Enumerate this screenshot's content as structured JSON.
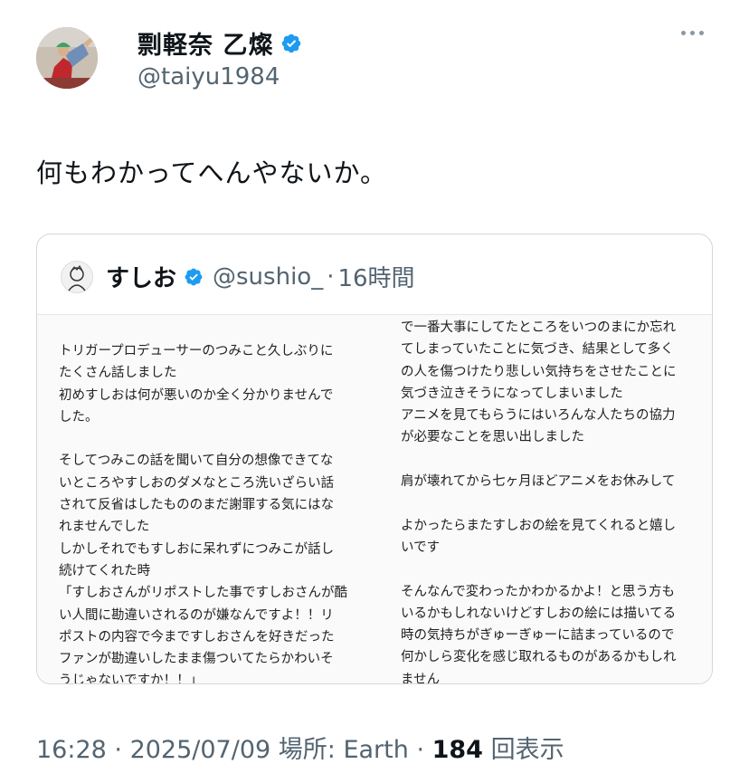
{
  "author": {
    "display_name": "剽軽奈 乙燦",
    "handle": "@taiyu1984",
    "verified_icon": "verified-badge-icon"
  },
  "tweet": {
    "text": "何もわかってへんやないか。"
  },
  "quoted": {
    "display_name": "すしお",
    "handle": "@sushio_",
    "separator": "·",
    "time": "16時間",
    "image_text_left": "トリガープロデューサーのつみこと久しぶりに\nたくさん話しました\n初めすしおは何が悪いのか全く分かりませんで\nした。\n\nそしてつみこの話を聞いて自分の想像できてな\nいところやすしおのダメなところ洗いざらい話\nされて反省はしたもののまだ謝罪する気にはな\nれませんでした\nしかしそれでもすしおに呆れずにつみこが話し\n続けてくれた時\n「すしおさんがリポストした事ですしおさんが酷\nい人間に勘違いされるのが嫌なんですよ！！リ\nポストの内容で今まですしおさんを好きだった\nファンが勘違いしたまま傷ついてたらかわいそ\nうじゃないですか！！」",
    "image_text_right": "で一番大事にしてたところをいつのまにか忘れ\nてしまっていたことに気づき、結果として多く\nの人を傷つけたり悲しい気持ちをさせたことに\n気づき泣きそうになってしまいました\nアニメを見てもらうにはいろんな人たちの協力\nが必要なことを思い出しました\n\n肩が壊れてから七ヶ月ほどアニメをお休みして\n\nよかったらまたすしおの絵を見てくれると嬉し\nいです\n\nそんなんで変わったかわかるかよ！と思う方も\nいるかもしれないけどすしおの絵には描いてる\n時の気持ちがぎゅーぎゅーに詰まっているので\n何かしら変化を感じ取れるものがあるかもしれ\nません"
  },
  "meta": {
    "time": "16:28",
    "dot1": " · ",
    "date": "2025/07/09",
    "location": " 場所: Earth",
    "dot2": " · ",
    "views_count": "184",
    "views_label": " 回表示"
  },
  "colors": {
    "verified_blue": "#1d9bf0",
    "secondary_text": "#536471",
    "border": "#cfd9de"
  }
}
